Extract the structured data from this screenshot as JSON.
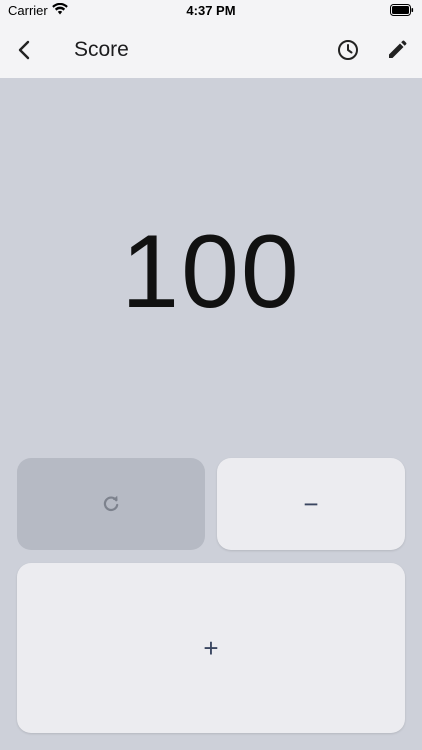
{
  "status_bar": {
    "carrier": "Carrier",
    "time": "4:37 PM",
    "wifi_icon": "wifi-icon",
    "battery_icon": "battery-icon"
  },
  "nav": {
    "title": "Score",
    "back_icon": "chevron-left-icon",
    "history_icon": "clock-icon",
    "edit_icon": "pencil-icon"
  },
  "score": {
    "value": "100"
  },
  "controls": {
    "reset_icon": "refresh-icon",
    "minus_label": "−",
    "plus_label": "+"
  },
  "colors": {
    "background": "#cdd0d9",
    "bar": "#f4f4f6",
    "button": "#ececf0",
    "button_disabled": "#b6bac4",
    "accent_text": "#3a4660"
  }
}
